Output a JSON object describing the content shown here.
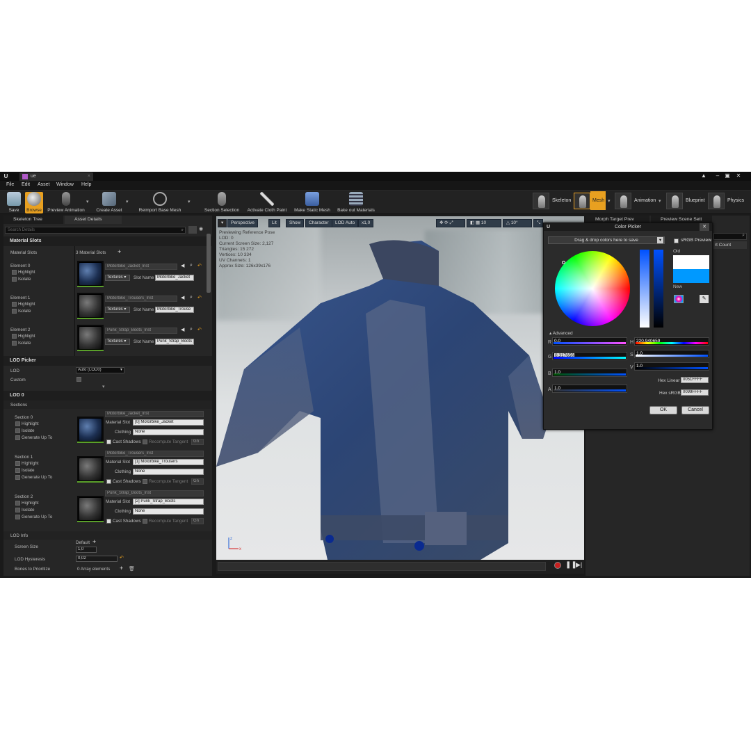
{
  "colors": {
    "accent_orange": "#e8a020",
    "viewport_bg": "#dfe2e3",
    "jacket_blue": "#2c4a7a",
    "new_color": "#0099ff",
    "old_color": "#ffffff"
  },
  "titlebar": {
    "doc_tab": "ue"
  },
  "menu": [
    "File",
    "Edit",
    "Asset",
    "Window",
    "Help"
  ],
  "toolbar": {
    "save": "Save",
    "browse": "Browse",
    "preview_animation": "Preview Animation",
    "create_asset": "Create Asset",
    "reimport": "Reimport Base Mesh",
    "section_selection": "Section Selection",
    "activate_cloth": "Activate Cloth Paint",
    "make_static": "Make Static Mesh",
    "bake_out": "Bake out Materials",
    "modes": [
      "Skeleton",
      "Mesh",
      "Animation",
      "Blueprint",
      "Physics"
    ]
  },
  "left_tabs": {
    "skeleton_tree": "Skeleton Tree",
    "asset_details": "Asset Details"
  },
  "search_placeholder": "Search Details",
  "material_slots": {
    "header": "Material Slots",
    "label": "Material Slots",
    "count": "3 Material Slots",
    "elements": [
      {
        "name": "Element 0",
        "material": "Motorbike_Jacket_Inst",
        "slot_name": "Motorbike_Jacket"
      },
      {
        "name": "Element 1",
        "material": "Motorbike_Trousers_Inst",
        "slot_name": "Motorbike_Trouse"
      },
      {
        "name": "Element 2",
        "material": "Punk_Strap_Boots_Inst",
        "slot_name": "Punk_Strap_Boots"
      }
    ],
    "highlight": "Highlight",
    "isolate": "Isolate",
    "textures": "Textures",
    "slot_name_label": "Slot Name"
  },
  "lod_picker": {
    "header": "LOD Picker",
    "lod_label": "LOD",
    "lod_value": "Auto (LOD0)",
    "custom_label": "Custom"
  },
  "lod0": {
    "header": "LOD 0",
    "sections_header": "Sections",
    "sections": [
      {
        "name": "Section 0",
        "material": "Motorbike_Jacket_Inst",
        "slot": "[0] Motorbike_Jacket"
      },
      {
        "name": "Section 1",
        "material": "Motorbike_Trousers_Inst",
        "slot": "[1] Motorbike_Trousers"
      },
      {
        "name": "Section 2",
        "material": "Punk_Strap_Boots_Inst",
        "slot": "[2] Punk_Strap_Boots"
      }
    ],
    "generate_up_to": "Generate Up To",
    "material_slot_label": "Material Slot",
    "clothing_label": "Clothing",
    "clothing_value": "None",
    "cast_shadows": "Cast Shadows",
    "recompute_tangent": "Recompute Tangent",
    "gn": "Gn"
  },
  "lod_info": {
    "header": "LOD Info",
    "screen_size_label": "Screen Size",
    "screen_size_default": "Default",
    "screen_size_value": "1,0",
    "hysteresis_label": "LOD Hysteresis",
    "hysteresis_value": "0,02",
    "bones_label": "Bones to Prioritize",
    "bones_value": "0 Array elements"
  },
  "viewport": {
    "perspective": "Perspective",
    "lit": "Lit",
    "show": "Show",
    "character": "Character",
    "lod_auto": "LOD Auto",
    "speed": "x1,0",
    "grid_value": "10",
    "angle_value": "10°",
    "stats": [
      "Previewing Reference Pose",
      "LOD: 0",
      "Current Screen Size: 2,127",
      "Triangles: 15 272",
      "Vertices: 10 334",
      "UV Channels: 1",
      "Approx Size: 126x39x176"
    ]
  },
  "right_tabs": {
    "morph_target": "Morph Target Prev",
    "preview_scene": "Preview Scene Sett"
  },
  "right_panel": {
    "vert_count": "rt Count"
  },
  "color_picker": {
    "title": "Color Picker",
    "drop_hint": "Drag & drop colors here to save",
    "srgb_preview": "sRGB Preview",
    "old_label": "Old",
    "new_label": "New",
    "advanced": "Advanced",
    "R": "0,0",
    "G": "0,317656",
    "B": "1,0",
    "A": "1,0",
    "H": "220,940659",
    "S": "1,0",
    "V": "1,0",
    "hex_linear_label": "Hex Linear",
    "hex_linear": "0051FFFF",
    "hex_srgb_label": "Hex sRGB",
    "hex_srgb": "0099FFFF",
    "ok": "OK",
    "cancel": "Cancel"
  }
}
